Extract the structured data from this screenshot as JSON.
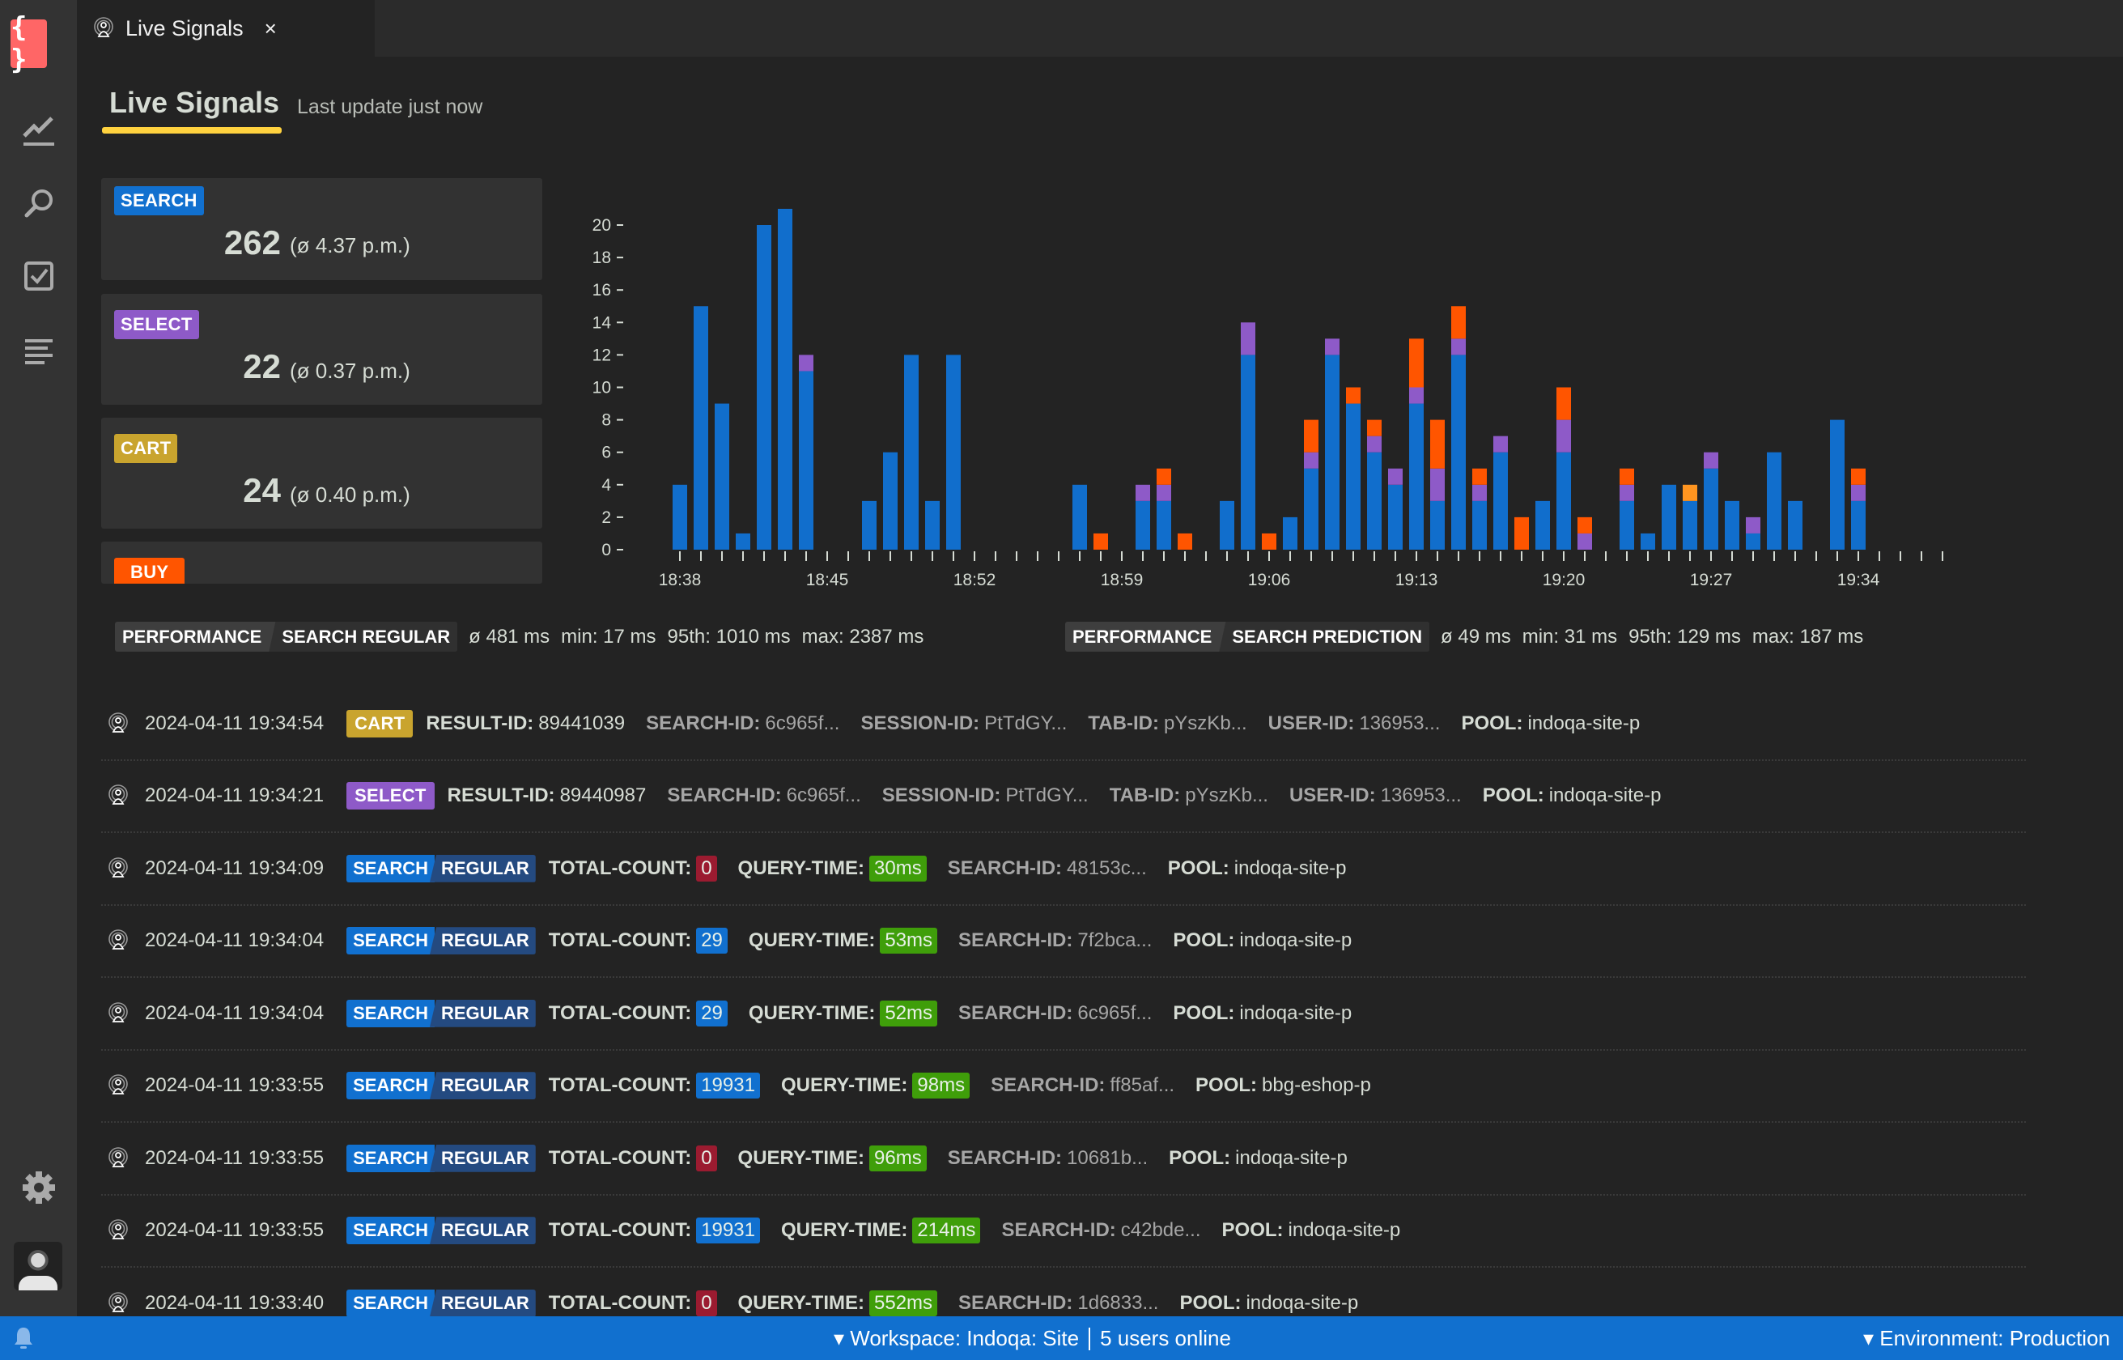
{
  "sidebar": {
    "logo": "{ }",
    "items": [
      {
        "icon": "chart-line-icon"
      },
      {
        "icon": "search-icon"
      },
      {
        "icon": "checkbox-icon"
      },
      {
        "icon": "list-icon"
      }
    ],
    "settings_icon": "gear-icon",
    "avatar": "user-avatar"
  },
  "tab": {
    "icon": "live-signal-icon",
    "label": "Live Signals",
    "close": "×"
  },
  "header": {
    "title": "Live Signals",
    "subtitle": "Last update just now",
    "accent": "#ffd23f"
  },
  "stats": [
    {
      "label": "SEARCH",
      "color": "#1170cf",
      "count": "262",
      "avg": "(ø 4.37 p.m.)"
    },
    {
      "label": "SELECT",
      "color": "#8e5ac8",
      "count": "22",
      "avg": "(ø 0.37 p.m.)"
    },
    {
      "label": "CART",
      "color": "#c9a42e",
      "count": "24",
      "avg": "(ø 0.40 p.m.)"
    },
    {
      "label": "BUY",
      "color": "#ff5500"
    }
  ],
  "chart_data": {
    "type": "bar",
    "stacked": true,
    "x_start": "18:38",
    "x_ticks": [
      "18:38",
      "18:45",
      "18:52",
      "18:59",
      "19:06",
      "19:13",
      "19:20",
      "19:27",
      "19:34"
    ],
    "y_ticks": [
      0,
      2,
      4,
      6,
      8,
      10,
      12,
      14,
      16,
      18,
      20
    ],
    "ylim": [
      0,
      21
    ],
    "grid": false,
    "series": [
      {
        "key": "search",
        "color": "#116ecc",
        "values": [
          4,
          15,
          9,
          1,
          20,
          21,
          11,
          0,
          0,
          3,
          6,
          12,
          3,
          12,
          0,
          0,
          0,
          0,
          0,
          4,
          0,
          0,
          3,
          3,
          0,
          0,
          3,
          12,
          0,
          2,
          5,
          12,
          9,
          6,
          4,
          9,
          3,
          12,
          3,
          6,
          0,
          3,
          6,
          0,
          0,
          3,
          1,
          4,
          3,
          5,
          3,
          1,
          6,
          3,
          0,
          8,
          3,
          0,
          0,
          0,
          0
        ]
      },
      {
        "key": "select",
        "color": "#8e5ac8",
        "values": [
          0,
          0,
          0,
          0,
          0,
          0,
          1,
          0,
          0,
          0,
          0,
          0,
          0,
          0,
          0,
          0,
          0,
          0,
          0,
          0,
          0,
          0,
          1,
          1,
          0,
          0,
          0,
          2,
          0,
          0,
          1,
          1,
          0,
          1,
          1,
          1,
          2,
          1,
          1,
          1,
          0,
          0,
          2,
          1,
          0,
          1,
          0,
          0,
          0,
          1,
          0,
          1,
          0,
          0,
          0,
          0,
          1,
          0,
          0,
          0,
          0
        ]
      },
      {
        "key": "cart",
        "color": "#ff5500",
        "values": [
          0,
          0,
          0,
          0,
          0,
          0,
          0,
          0,
          0,
          0,
          0,
          0,
          0,
          0,
          0,
          0,
          0,
          0,
          0,
          0,
          1,
          0,
          0,
          1,
          1,
          0,
          0,
          0,
          1,
          0,
          2,
          0,
          1,
          1,
          0,
          3,
          3,
          2,
          1,
          0,
          2,
          0,
          2,
          1,
          0,
          1,
          0,
          0,
          0,
          0,
          0,
          0,
          0,
          0,
          0,
          0,
          1,
          0,
          0,
          0,
          0
        ]
      },
      {
        "key": "buy",
        "color": "#ff9520",
        "values": [
          0,
          0,
          0,
          0,
          0,
          0,
          0,
          0,
          0,
          0,
          0,
          0,
          0,
          0,
          0,
          0,
          0,
          0,
          0,
          0,
          0,
          0,
          0,
          0,
          0,
          0,
          0,
          0,
          0,
          0,
          0,
          0,
          0,
          0,
          0,
          0,
          0,
          0,
          0,
          0,
          0,
          0,
          0,
          0,
          0,
          0,
          0,
          0,
          1,
          0,
          0,
          0,
          0,
          0,
          0,
          0,
          0,
          0,
          0,
          0,
          0
        ]
      }
    ]
  },
  "performance": [
    {
      "label": "PERFORMANCE",
      "name": "SEARCH REGULAR",
      "avg": "ø 481 ms",
      "min": "min: 17 ms",
      "p95": "95th: 1010 ms",
      "max": "max: 2387 ms"
    },
    {
      "label": "PERFORMANCE",
      "name": "SEARCH PREDICTION",
      "avg": "ø 49 ms",
      "min": "min: 31 ms",
      "p95": "95th: 129 ms",
      "max": "max: 187 ms"
    }
  ],
  "log": [
    {
      "time": "2024-04-11 19:34:54",
      "type": [
        "CART"
      ],
      "color": "#c9a42e",
      "fields": [
        {
          "k": "RESULT-ID:",
          "v": "89441039"
        },
        {
          "k": "SEARCH-ID:",
          "v": "6c965f...",
          "dim": true
        },
        {
          "k": "SESSION-ID:",
          "v": "PtTdGY...",
          "dim": true
        },
        {
          "k": "TAB-ID:",
          "v": "pYszKb...",
          "dim": true
        },
        {
          "k": "USER-ID:",
          "v": "136953...",
          "dim": true
        },
        {
          "k": "POOL:",
          "v": "indoqa-site-p"
        }
      ]
    },
    {
      "time": "2024-04-11 19:34:21",
      "type": [
        "SELECT"
      ],
      "color": "#8e5ac8",
      "fields": [
        {
          "k": "RESULT-ID:",
          "v": "89440987"
        },
        {
          "k": "SEARCH-ID:",
          "v": "6c965f...",
          "dim": true
        },
        {
          "k": "SESSION-ID:",
          "v": "PtTdGY...",
          "dim": true
        },
        {
          "k": "TAB-ID:",
          "v": "pYszKb...",
          "dim": true
        },
        {
          "k": "USER-ID:",
          "v": "136953...",
          "dim": true
        },
        {
          "k": "POOL:",
          "v": "indoqa-site-p"
        }
      ]
    },
    {
      "time": "2024-04-11 19:34:09",
      "type": [
        "SEARCH",
        "REGULAR"
      ],
      "fields": [
        {
          "k": "TOTAL-COUNT:",
          "v": "0",
          "badge": "#9b1b30"
        },
        {
          "k": "QUERY-TIME:",
          "v": "30ms",
          "badge": "#3f9e0a"
        },
        {
          "k": "SEARCH-ID:",
          "v": "48153c...",
          "dim": true
        },
        {
          "k": "POOL:",
          "v": "indoqa-site-p"
        }
      ]
    },
    {
      "time": "2024-04-11 19:34:04",
      "type": [
        "SEARCH",
        "REGULAR"
      ],
      "fields": [
        {
          "k": "TOTAL-COUNT:",
          "v": "29",
          "badge": "#1170cf"
        },
        {
          "k": "QUERY-TIME:",
          "v": "53ms",
          "badge": "#3f9e0a"
        },
        {
          "k": "SEARCH-ID:",
          "v": "7f2bca...",
          "dim": true
        },
        {
          "k": "POOL:",
          "v": "indoqa-site-p"
        }
      ]
    },
    {
      "time": "2024-04-11 19:34:04",
      "type": [
        "SEARCH",
        "REGULAR"
      ],
      "fields": [
        {
          "k": "TOTAL-COUNT:",
          "v": "29",
          "badge": "#1170cf"
        },
        {
          "k": "QUERY-TIME:",
          "v": "52ms",
          "badge": "#3f9e0a"
        },
        {
          "k": "SEARCH-ID:",
          "v": "6c965f...",
          "dim": true
        },
        {
          "k": "POOL:",
          "v": "indoqa-site-p"
        }
      ]
    },
    {
      "time": "2024-04-11 19:33:55",
      "type": [
        "SEARCH",
        "REGULAR"
      ],
      "fields": [
        {
          "k": "TOTAL-COUNT:",
          "v": "19931",
          "badge": "#1170cf"
        },
        {
          "k": "QUERY-TIME:",
          "v": "98ms",
          "badge": "#3f9e0a"
        },
        {
          "k": "SEARCH-ID:",
          "v": "ff85af...",
          "dim": true
        },
        {
          "k": "POOL:",
          "v": "bbg-eshop-p"
        }
      ]
    },
    {
      "time": "2024-04-11 19:33:55",
      "type": [
        "SEARCH",
        "REGULAR"
      ],
      "fields": [
        {
          "k": "TOTAL-COUNT:",
          "v": "0",
          "badge": "#9b1b30"
        },
        {
          "k": "QUERY-TIME:",
          "v": "96ms",
          "badge": "#3f9e0a"
        },
        {
          "k": "SEARCH-ID:",
          "v": "10681b...",
          "dim": true
        },
        {
          "k": "POOL:",
          "v": "indoqa-site-p"
        }
      ]
    },
    {
      "time": "2024-04-11 19:33:55",
      "type": [
        "SEARCH",
        "REGULAR"
      ],
      "fields": [
        {
          "k": "TOTAL-COUNT:",
          "v": "19931",
          "badge": "#1170cf"
        },
        {
          "k": "QUERY-TIME:",
          "v": "214ms",
          "badge": "#3f9e0a"
        },
        {
          "k": "SEARCH-ID:",
          "v": "c42bde...",
          "dim": true
        },
        {
          "k": "POOL:",
          "v": "indoqa-site-p"
        }
      ]
    },
    {
      "time": "2024-04-11 19:33:40",
      "type": [
        "SEARCH",
        "REGULAR"
      ],
      "fields": [
        {
          "k": "TOTAL-COUNT:",
          "v": "0",
          "badge": "#9b1b30"
        },
        {
          "k": "QUERY-TIME:",
          "v": "552ms",
          "badge": "#3f9e0a"
        },
        {
          "k": "SEARCH-ID:",
          "v": "1d6833...",
          "dim": true
        },
        {
          "k": "POOL:",
          "v": "indoqa-site-p"
        }
      ]
    }
  ],
  "status": {
    "bell_icon": "bell-icon",
    "workspace": "▾ Workspace: Indoqa: Site",
    "users": "5 users online",
    "environment": "▾ Environment: Production",
    "color": "#1170cf"
  }
}
